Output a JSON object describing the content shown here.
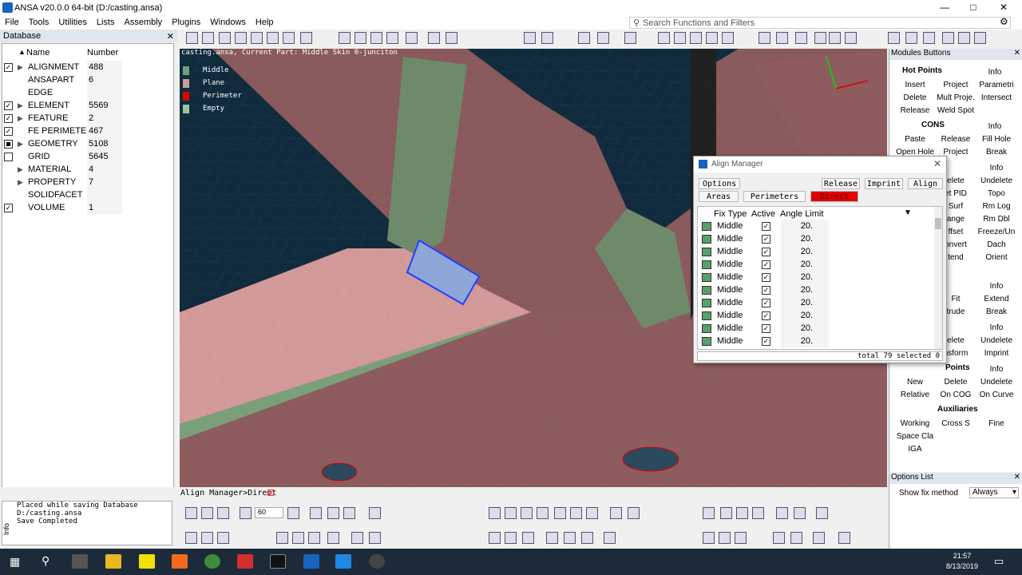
{
  "window": {
    "title": "ANSA v20.0.0 64-bit (D:/casting.ansa)"
  },
  "menu": [
    "File",
    "Tools",
    "Utilities",
    "Lists",
    "Assembly",
    "Plugins",
    "Windows",
    "Help"
  ],
  "search": {
    "placeholder": "Search Functions and Filters"
  },
  "database": {
    "title": "Database",
    "col_name": "Name",
    "col_number": "Number",
    "rows": [
      {
        "check": "checked",
        "expand": true,
        "name": "ALIGNMENT",
        "number": "488"
      },
      {
        "check": "none",
        "expand": false,
        "name": "ANSAPART",
        "number": "6"
      },
      {
        "check": "none",
        "expand": false,
        "name": "EDGE",
        "number": ""
      },
      {
        "check": "checked",
        "expand": true,
        "name": "ELEMENT",
        "number": "5569"
      },
      {
        "check": "checked",
        "expand": true,
        "name": "FEATURE",
        "number": "2"
      },
      {
        "check": "checked",
        "expand": false,
        "name": "FE PERIMETER",
        "number": "467"
      },
      {
        "check": "filled",
        "expand": true,
        "name": "GEOMETRY",
        "number": "5108"
      },
      {
        "check": "unchecked",
        "expand": false,
        "name": "GRID",
        "number": "5645"
      },
      {
        "check": "none",
        "expand": true,
        "name": "MATERIAL",
        "number": "4"
      },
      {
        "check": "none",
        "expand": true,
        "name": "PROPERTY",
        "number": "7"
      },
      {
        "check": "none",
        "expand": false,
        "name": "SOLIDFACET",
        "number": ""
      },
      {
        "check": "checked",
        "expand": false,
        "name": "VOLUME",
        "number": "1"
      }
    ]
  },
  "viewport": {
    "info": "casting.ansa,  Current Part: Middle Skin 0-junciton",
    "legend": [
      {
        "label": "Middle",
        "color": "#6ea07a"
      },
      {
        "label": "Plane",
        "color": "#c99a9a"
      },
      {
        "label": "Perimeter",
        "color": "#e00000"
      },
      {
        "label": "Empty",
        "color": "#9cc49a"
      }
    ]
  },
  "align_manager": {
    "title": "Align Manager",
    "options": "Options",
    "release": "Release",
    "imprint": "Imprint",
    "align": "Align",
    "tabs": [
      "Areas",
      "Perimeters",
      "Direct"
    ],
    "columns": [
      "Fix Type",
      "Active",
      "Angle Limit"
    ],
    "rows": [
      "Middle",
      "Middle",
      "Middle",
      "Middle",
      "Middle",
      "Middle",
      "Middle",
      "Middle",
      "Middle",
      "Middle"
    ],
    "angle": "20.",
    "footer": "total 79 selected 0"
  },
  "modules": {
    "title": "Modules Buttons",
    "hot_points": "Hot Points",
    "info": "Info",
    "hp_buttons": [
      "Insert",
      "Project",
      "Parametri",
      "Delete",
      "Mult Proje.",
      "Intersect",
      "Release",
      "Weld Spot"
    ],
    "cons": "CONS",
    "cons_buttons": [
      "Paste",
      "Release",
      "Fill Hole",
      "Open Hole",
      "Project",
      "Break"
    ],
    "right_col": [
      "Info",
      "Undelete",
      "Topo",
      "Rm Log",
      "Rm Dbl",
      "Freeze/Un",
      "Dach",
      "Orient"
    ],
    "left_partial": [
      "elete",
      "et PID",
      "Surf",
      "ange",
      "ffset",
      "onvert",
      "tend"
    ],
    "sect3": [
      "Info",
      "Fit",
      "Extend",
      "trude",
      "Break"
    ],
    "sect4": [
      "Info",
      "elete",
      "Undelete",
      "nsform",
      "Imprint"
    ],
    "points": "Points",
    "points_buttons": [
      "New",
      "Delete",
      "Undelete",
      "Relative",
      "On COG",
      "On Curve"
    ],
    "auxiliaries": "Auxiliaries",
    "aux_buttons": [
      "Working",
      "Cross S",
      "Fine",
      "Space Cla",
      "IGA"
    ]
  },
  "options_list": {
    "title": "Options List",
    "label": "Show fix method",
    "value": "Always"
  },
  "bottom": {
    "tab": "Align Manager>Direct",
    "log": [
      "Placed while saving Database",
      "D:/casting.ansa",
      "Save Completed"
    ],
    "angle_value": "60"
  },
  "clock": {
    "time": "21:57",
    "date": "8/13/2019"
  }
}
